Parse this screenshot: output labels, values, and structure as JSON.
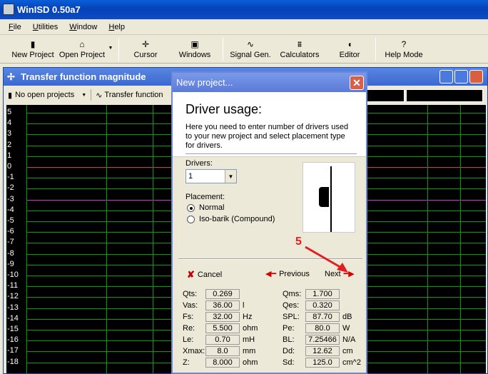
{
  "app": {
    "title": "WinISD 0.50a7"
  },
  "menu": [
    {
      "label_u": "F",
      "label_rest": "ile"
    },
    {
      "label_u": "U",
      "label_rest": "tilities"
    },
    {
      "label_u": "W",
      "label_rest": "indow"
    },
    {
      "label_u": "H",
      "label_rest": "elp"
    }
  ],
  "toolbar": {
    "new_project": "New Project",
    "open_project": "Open Project",
    "cursor": "Cursor",
    "windows": "Windows",
    "signal_gen": "Signal Gen.",
    "calculators": "Calculators",
    "editor": "Editor",
    "help_mode": "Help Mode"
  },
  "tf_window": {
    "title": "Transfer function magnitude",
    "project_select": "No open projects",
    "transfer_button": "Transfer function"
  },
  "plot": {
    "y_ticks": [
      "5",
      "4",
      "3",
      "2",
      "1",
      "0",
      "-1",
      "-2",
      "-3",
      "-4",
      "-5",
      "-6",
      "-7",
      "-8",
      "-9",
      "-10",
      "-11",
      "-12",
      "-13",
      "-14",
      "-15",
      "-16",
      "-17",
      "-18"
    ]
  },
  "dialog": {
    "title": "New project...",
    "heading": "Driver usage:",
    "description": "Here you need to enter number of drivers used to your new project and select placement type for drivers.",
    "drivers_label": "Drivers:",
    "drivers_value": "1",
    "placement_label": "Placement:",
    "placement_normal": "Normal",
    "placement_isobarik": "Iso-barik (Compound)",
    "cancel": "Cancel",
    "previous": "Previous",
    "next": "Next"
  },
  "params_left": [
    {
      "label": "Qts:",
      "value": "0.269",
      "unit": ""
    },
    {
      "label": "Vas:",
      "value": "36.00",
      "unit": "l"
    },
    {
      "label": "Fs:",
      "value": "32.00",
      "unit": "Hz"
    },
    {
      "label": "Re:",
      "value": "5.500",
      "unit": "ohm"
    },
    {
      "label": "Le:",
      "value": "0.70",
      "unit": "mH"
    },
    {
      "label": "Xmax:",
      "value": "8.0",
      "unit": "mm"
    },
    {
      "label": "Z:",
      "value": "8.000",
      "unit": "ohm"
    }
  ],
  "params_right": [
    {
      "label": "Qms:",
      "value": "1.700",
      "unit": ""
    },
    {
      "label": "Qes:",
      "value": "0.320",
      "unit": ""
    },
    {
      "label": "SPL:",
      "value": "87.70",
      "unit": "dB"
    },
    {
      "label": "Pe:",
      "value": "80.0",
      "unit": "W"
    },
    {
      "label": "BL:",
      "value": "7.25466",
      "unit": "N/A"
    },
    {
      "label": "Dd:",
      "value": "12.62",
      "unit": "cm"
    },
    {
      "label": "Sd:",
      "value": "125.0",
      "unit": "cm^2"
    }
  ],
  "annotation": {
    "step": "5"
  },
  "colors": {
    "accent": "#0b4bc4",
    "plot_bg": "#000000",
    "grid": "#00a000",
    "annotation": "#e02020"
  }
}
